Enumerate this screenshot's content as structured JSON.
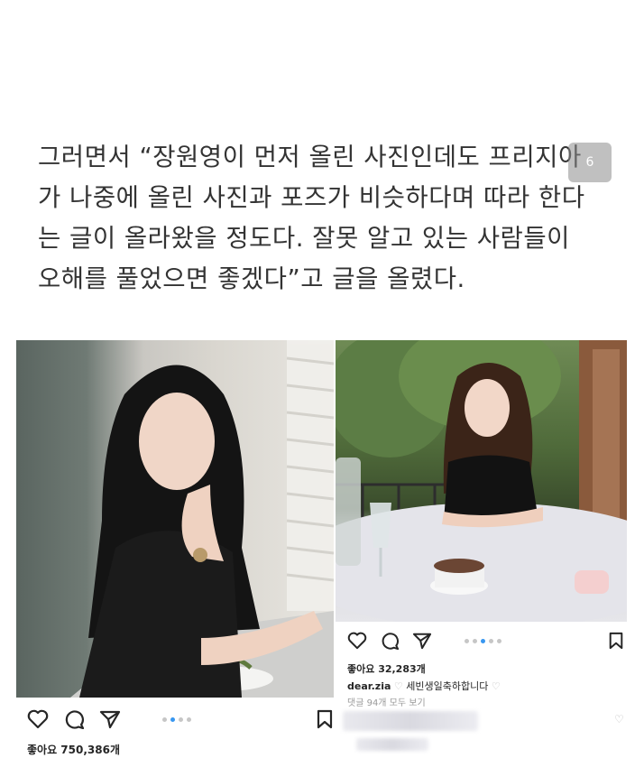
{
  "article": {
    "lines": [
      "그러면서 “장원영이 먼저 올린 사진인데도 프리지아",
      "가 나중에 올린 사진과 포즈가 비슷하다며 따라 한다",
      "는 글이 올라왔을 정도다. 잘못 알고 있는 사람들이",
      "오해를 풀었으면 좋겠다”고 글을 올렸다."
    ]
  },
  "page_badge": "6",
  "left_post": {
    "likes": "좋아요 750,386개",
    "carousel_count": 4,
    "carousel_active": 2
  },
  "right_post": {
    "likes": "좋아요 32,283개",
    "username": "dear.zia",
    "caption": "세빈생일축하합니다",
    "comments_link": "댓글 94개 모두 보기",
    "carousel_count": 5,
    "carousel_active": 3
  },
  "colors": {
    "text": "#262626",
    "article_text": "#333333",
    "carousel_active": "#3897f0",
    "carousel_inactive": "#c6c6c6"
  },
  "icons": [
    "heart-icon",
    "comment-icon",
    "share-icon",
    "bookmark-icon"
  ]
}
